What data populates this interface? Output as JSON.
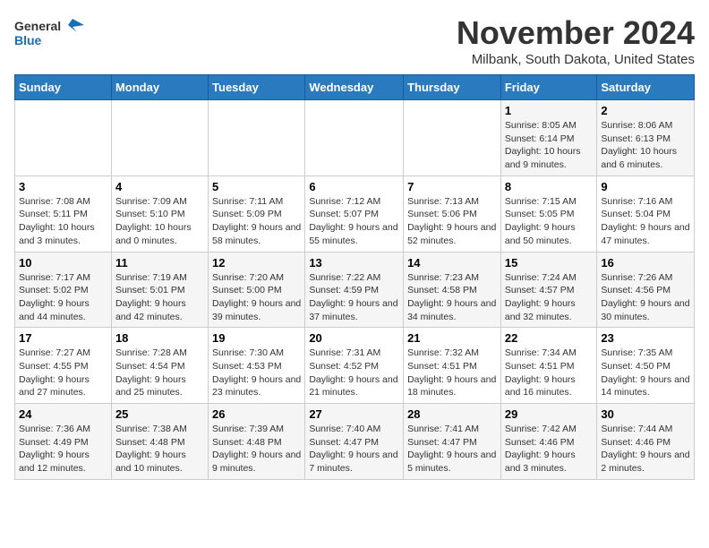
{
  "logo": {
    "general": "General",
    "blue": "Blue"
  },
  "header": {
    "month_title": "November 2024",
    "location": "Milbank, South Dakota, United States"
  },
  "days_of_week": [
    "Sunday",
    "Monday",
    "Tuesday",
    "Wednesday",
    "Thursday",
    "Friday",
    "Saturday"
  ],
  "weeks": [
    [
      {
        "day": "",
        "info": ""
      },
      {
        "day": "",
        "info": ""
      },
      {
        "day": "",
        "info": ""
      },
      {
        "day": "",
        "info": ""
      },
      {
        "day": "",
        "info": ""
      },
      {
        "day": "1",
        "info": "Sunrise: 8:05 AM\nSunset: 6:14 PM\nDaylight: 10 hours and 9 minutes."
      },
      {
        "day": "2",
        "info": "Sunrise: 8:06 AM\nSunset: 6:13 PM\nDaylight: 10 hours and 6 minutes."
      }
    ],
    [
      {
        "day": "3",
        "info": "Sunrise: 7:08 AM\nSunset: 5:11 PM\nDaylight: 10 hours and 3 minutes."
      },
      {
        "day": "4",
        "info": "Sunrise: 7:09 AM\nSunset: 5:10 PM\nDaylight: 10 hours and 0 minutes."
      },
      {
        "day": "5",
        "info": "Sunrise: 7:11 AM\nSunset: 5:09 PM\nDaylight: 9 hours and 58 minutes."
      },
      {
        "day": "6",
        "info": "Sunrise: 7:12 AM\nSunset: 5:07 PM\nDaylight: 9 hours and 55 minutes."
      },
      {
        "day": "7",
        "info": "Sunrise: 7:13 AM\nSunset: 5:06 PM\nDaylight: 9 hours and 52 minutes."
      },
      {
        "day": "8",
        "info": "Sunrise: 7:15 AM\nSunset: 5:05 PM\nDaylight: 9 hours and 50 minutes."
      },
      {
        "day": "9",
        "info": "Sunrise: 7:16 AM\nSunset: 5:04 PM\nDaylight: 9 hours and 47 minutes."
      }
    ],
    [
      {
        "day": "10",
        "info": "Sunrise: 7:17 AM\nSunset: 5:02 PM\nDaylight: 9 hours and 44 minutes."
      },
      {
        "day": "11",
        "info": "Sunrise: 7:19 AM\nSunset: 5:01 PM\nDaylight: 9 hours and 42 minutes."
      },
      {
        "day": "12",
        "info": "Sunrise: 7:20 AM\nSunset: 5:00 PM\nDaylight: 9 hours and 39 minutes."
      },
      {
        "day": "13",
        "info": "Sunrise: 7:22 AM\nSunset: 4:59 PM\nDaylight: 9 hours and 37 minutes."
      },
      {
        "day": "14",
        "info": "Sunrise: 7:23 AM\nSunset: 4:58 PM\nDaylight: 9 hours and 34 minutes."
      },
      {
        "day": "15",
        "info": "Sunrise: 7:24 AM\nSunset: 4:57 PM\nDaylight: 9 hours and 32 minutes."
      },
      {
        "day": "16",
        "info": "Sunrise: 7:26 AM\nSunset: 4:56 PM\nDaylight: 9 hours and 30 minutes."
      }
    ],
    [
      {
        "day": "17",
        "info": "Sunrise: 7:27 AM\nSunset: 4:55 PM\nDaylight: 9 hours and 27 minutes."
      },
      {
        "day": "18",
        "info": "Sunrise: 7:28 AM\nSunset: 4:54 PM\nDaylight: 9 hours and 25 minutes."
      },
      {
        "day": "19",
        "info": "Sunrise: 7:30 AM\nSunset: 4:53 PM\nDaylight: 9 hours and 23 minutes."
      },
      {
        "day": "20",
        "info": "Sunrise: 7:31 AM\nSunset: 4:52 PM\nDaylight: 9 hours and 21 minutes."
      },
      {
        "day": "21",
        "info": "Sunrise: 7:32 AM\nSunset: 4:51 PM\nDaylight: 9 hours and 18 minutes."
      },
      {
        "day": "22",
        "info": "Sunrise: 7:34 AM\nSunset: 4:51 PM\nDaylight: 9 hours and 16 minutes."
      },
      {
        "day": "23",
        "info": "Sunrise: 7:35 AM\nSunset: 4:50 PM\nDaylight: 9 hours and 14 minutes."
      }
    ],
    [
      {
        "day": "24",
        "info": "Sunrise: 7:36 AM\nSunset: 4:49 PM\nDaylight: 9 hours and 12 minutes."
      },
      {
        "day": "25",
        "info": "Sunrise: 7:38 AM\nSunset: 4:48 PM\nDaylight: 9 hours and 10 minutes."
      },
      {
        "day": "26",
        "info": "Sunrise: 7:39 AM\nSunset: 4:48 PM\nDaylight: 9 hours and 9 minutes."
      },
      {
        "day": "27",
        "info": "Sunrise: 7:40 AM\nSunset: 4:47 PM\nDaylight: 9 hours and 7 minutes."
      },
      {
        "day": "28",
        "info": "Sunrise: 7:41 AM\nSunset: 4:47 PM\nDaylight: 9 hours and 5 minutes."
      },
      {
        "day": "29",
        "info": "Sunrise: 7:42 AM\nSunset: 4:46 PM\nDaylight: 9 hours and 3 minutes."
      },
      {
        "day": "30",
        "info": "Sunrise: 7:44 AM\nSunset: 4:46 PM\nDaylight: 9 hours and 2 minutes."
      }
    ]
  ]
}
